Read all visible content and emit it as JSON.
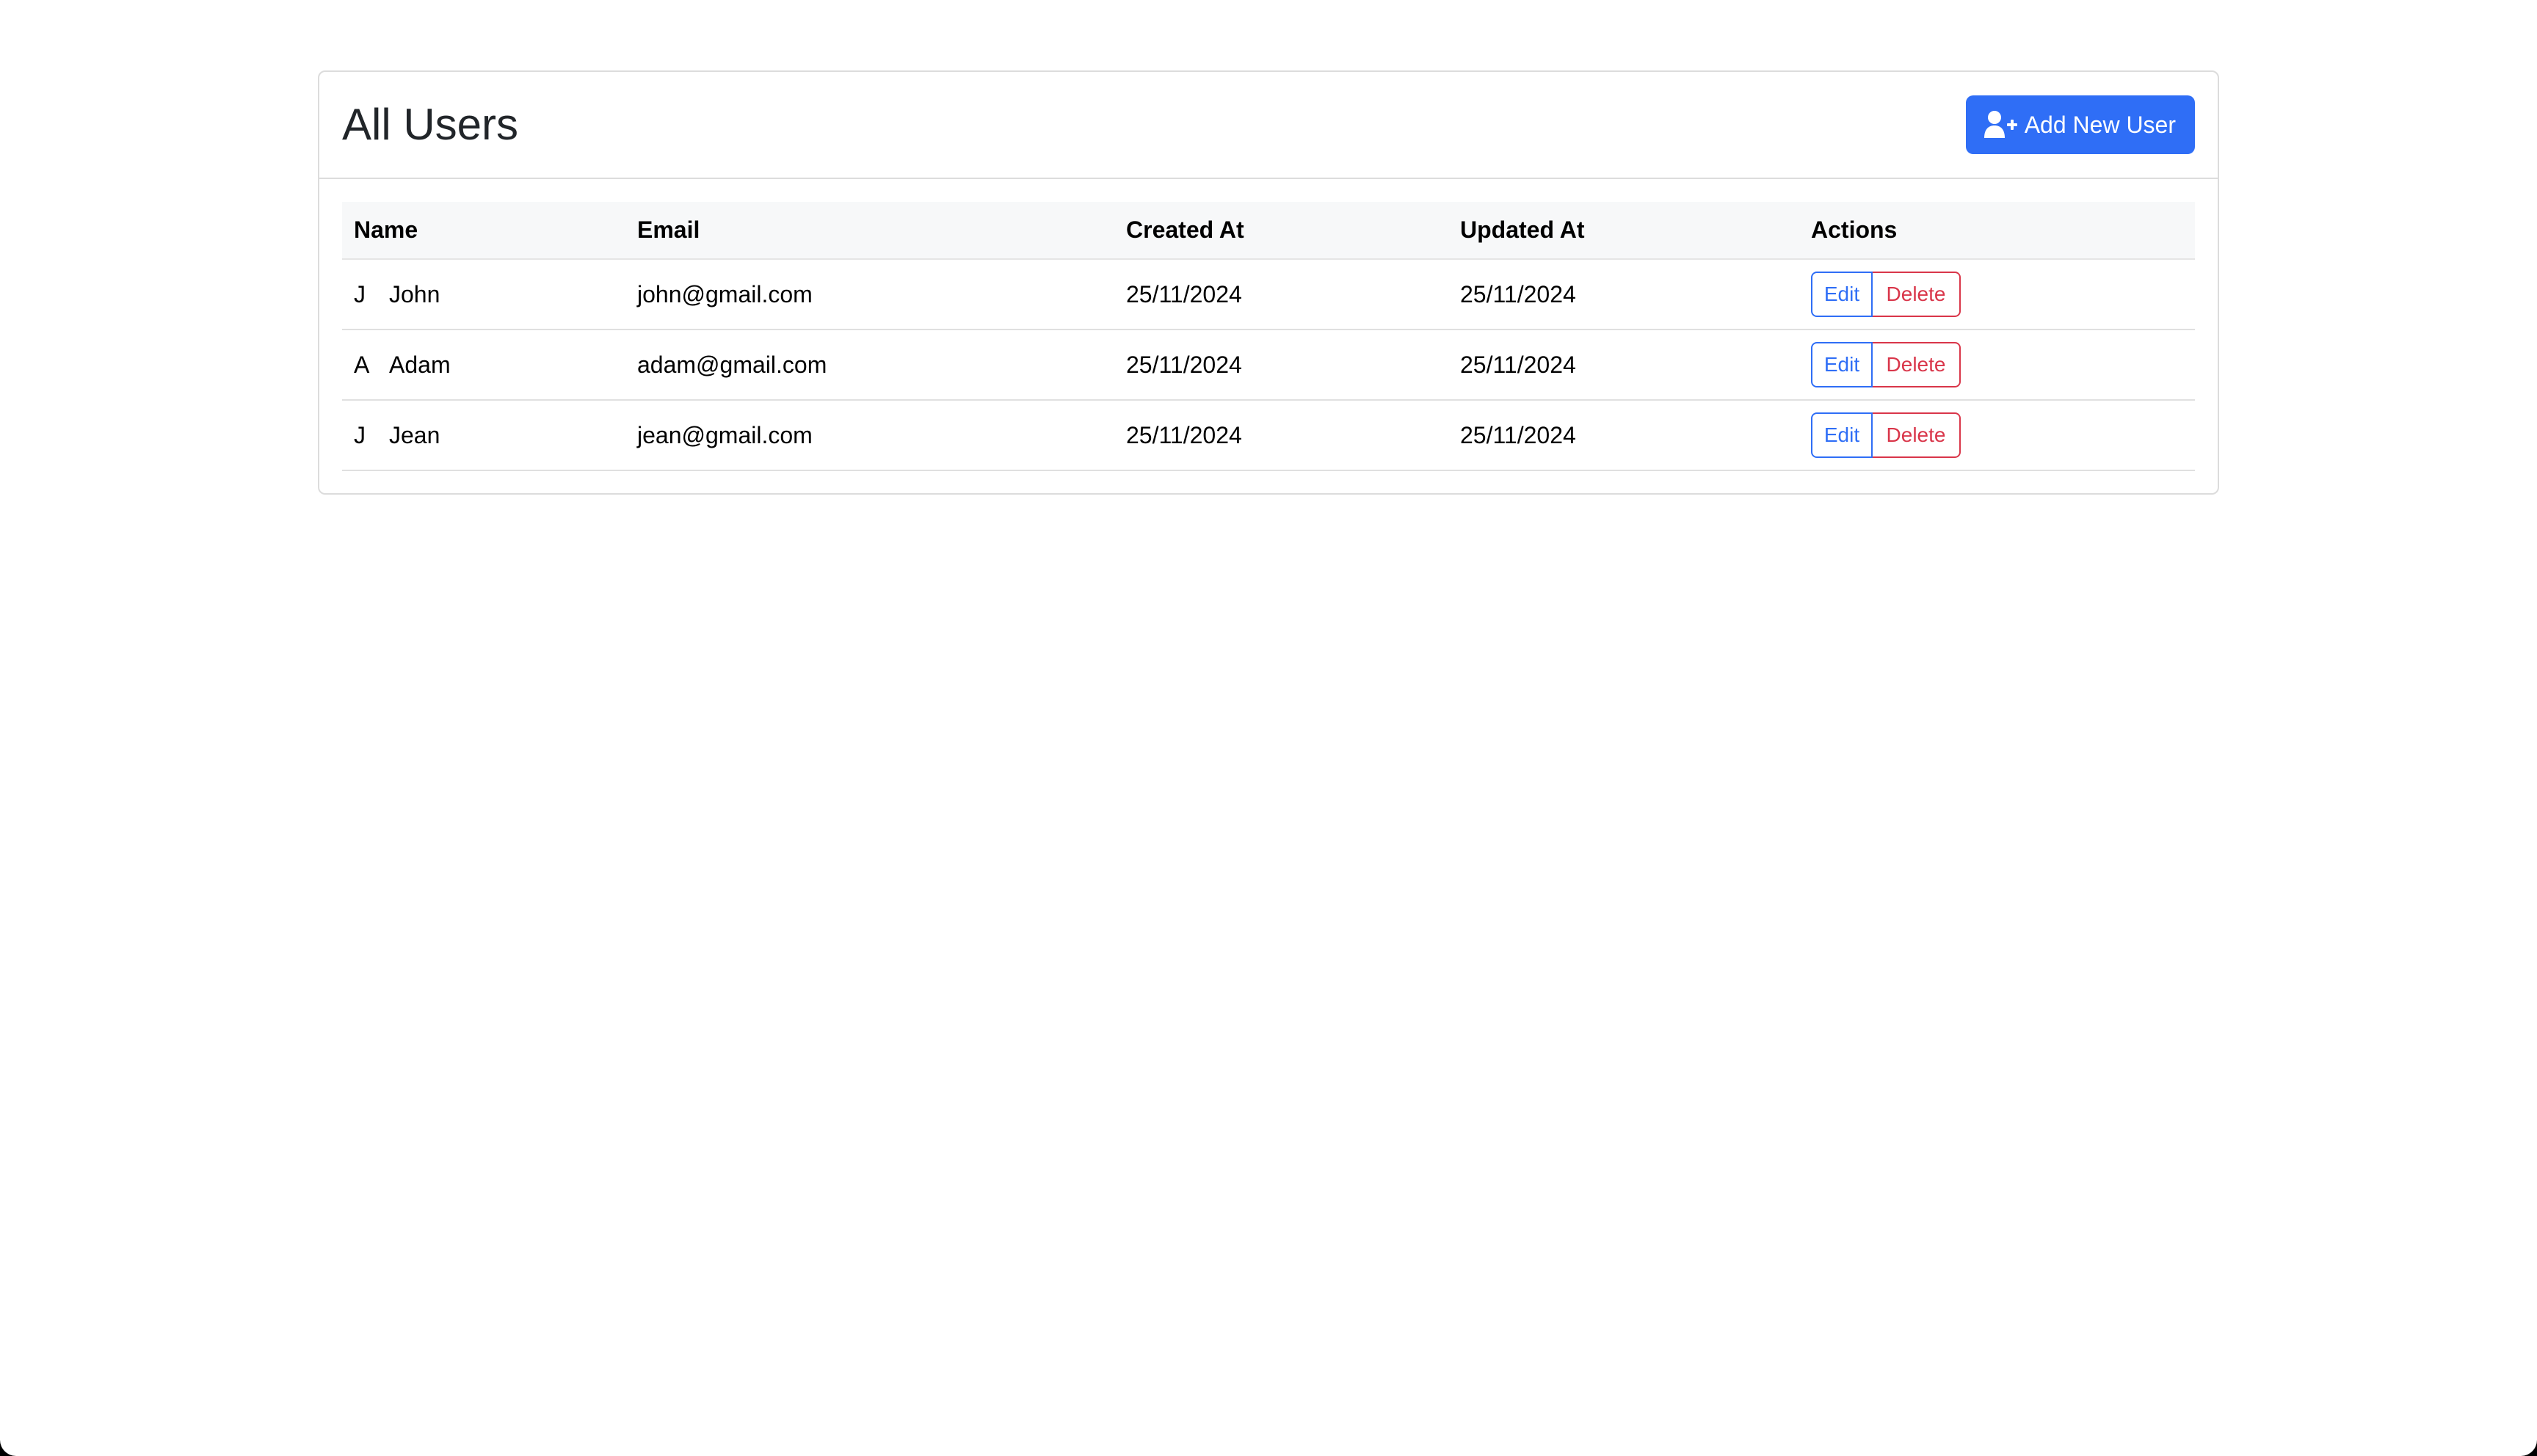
{
  "page": {
    "title": "All Users",
    "add_button_label": "Add New User"
  },
  "table": {
    "headers": [
      "Name",
      "Email",
      "Created At",
      "Updated At",
      "Actions"
    ],
    "rows": [
      {
        "initial": "J",
        "name": "John",
        "email": "john@gmail.com",
        "created_at": "25/11/2024",
        "updated_at": "25/11/2024"
      },
      {
        "initial": "A",
        "name": "Adam",
        "email": "adam@gmail.com",
        "created_at": "25/11/2024",
        "updated_at": "25/11/2024"
      },
      {
        "initial": "J",
        "name": "Jean",
        "email": "jean@gmail.com",
        "created_at": "25/11/2024",
        "updated_at": "25/11/2024"
      }
    ],
    "edit_label": "Edit",
    "delete_label": "Delete"
  },
  "colors": {
    "primary": "#2f6ef6",
    "danger": "#d9364a",
    "header_bg": "#f7f8f9"
  },
  "icons": {
    "add_button": "user-plus-icon"
  }
}
